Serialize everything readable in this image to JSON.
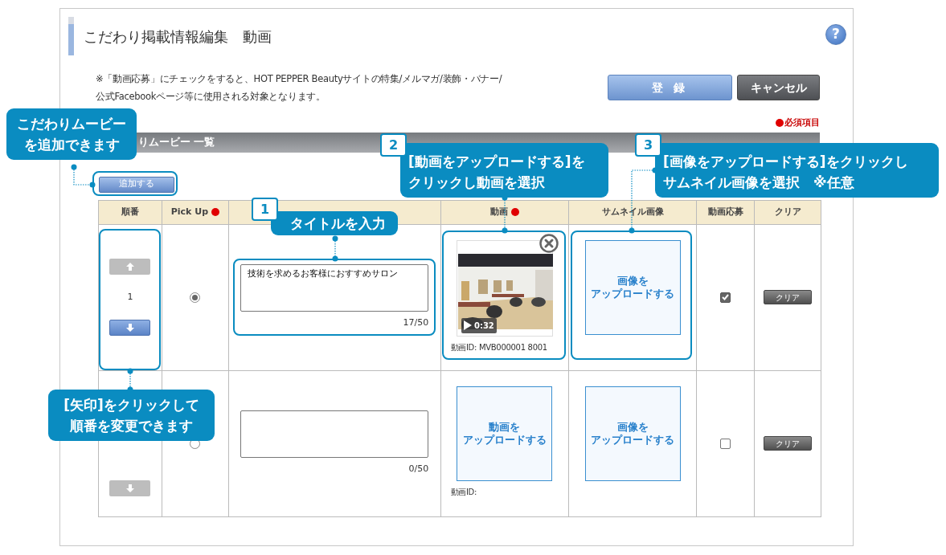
{
  "page": {
    "title": "こだわり掲載情報編集　動画",
    "help": "?",
    "note_lines": [
      "※「動画応募」にチェックをすると、HOT PEPPER Beautyサイトの特集/メルマガ/装飾・バナー/",
      "公式Facebookページ等に使用される対象となります。"
    ],
    "buttons": [
      {
        "label": "登 録",
        "kind": "primary"
      },
      {
        "label": "キャンセル",
        "kind": "secondary"
      }
    ],
    "required_legend": "必須項目"
  },
  "section": {
    "title": "りムービー 一覧",
    "add_button": "追加する"
  },
  "table": {
    "columns": [
      {
        "label": "順番",
        "required": false
      },
      {
        "label": "Pick Up",
        "required": true
      },
      {
        "required": false
      },
      {
        "label": "動画",
        "required": true
      },
      {
        "label": "サムネイル画像",
        "required": false
      },
      {
        "label": "動画応募",
        "required": false
      },
      {
        "label": "クリア",
        "required": false
      }
    ],
    "rows": [
      {
        "order": "1",
        "up_arrow": {
          "disabled": true
        },
        "down_arrow": {
          "disabled": false
        },
        "pick_up": {
          "selected": true
        },
        "title_value": "技術を求めるお客様におすすめサロン",
        "counter": "17/50",
        "video": {
          "kind": "uploaded",
          "duration": "0:32"
        },
        "video_id": "動画ID: MVB000001 8001",
        "thumbnail": {
          "kind": "empty",
          "lines": [
            "画像を",
            "アップロードする"
          ]
        },
        "apply": {
          "checked": true
        },
        "clear": "クリア"
      },
      {
        "down_arrow": {
          "disabled": true
        },
        "pick_up": {
          "selected": false
        },
        "counter": "0/50",
        "video": {
          "kind": "empty",
          "lines": [
            "動画を",
            "アップロードする"
          ]
        },
        "video_id": "動画ID:",
        "thumbnail": {
          "kind": "empty",
          "lines": [
            "画像を",
            "アップロードする"
          ]
        },
        "apply": {
          "checked": false
        },
        "clear": "クリア"
      }
    ]
  },
  "callouts": [
    {
      "lines": [
        "こだわりムービー",
        "を追加できます"
      ]
    },
    {
      "number": "1",
      "lines": [
        "タイトルを入力"
      ]
    },
    {
      "number": "2",
      "lines": [
        "[動画をアップロードする]を",
        "クリックし動画を選択"
      ]
    },
    {
      "number": "3",
      "lines": [
        "[画像をアップロードする]をクリックし",
        "サムネイル画像を選択　※任意"
      ]
    },
    {
      "lines": [
        "[矢印]をクリックして",
        "順番を変更できます"
      ]
    }
  ]
}
